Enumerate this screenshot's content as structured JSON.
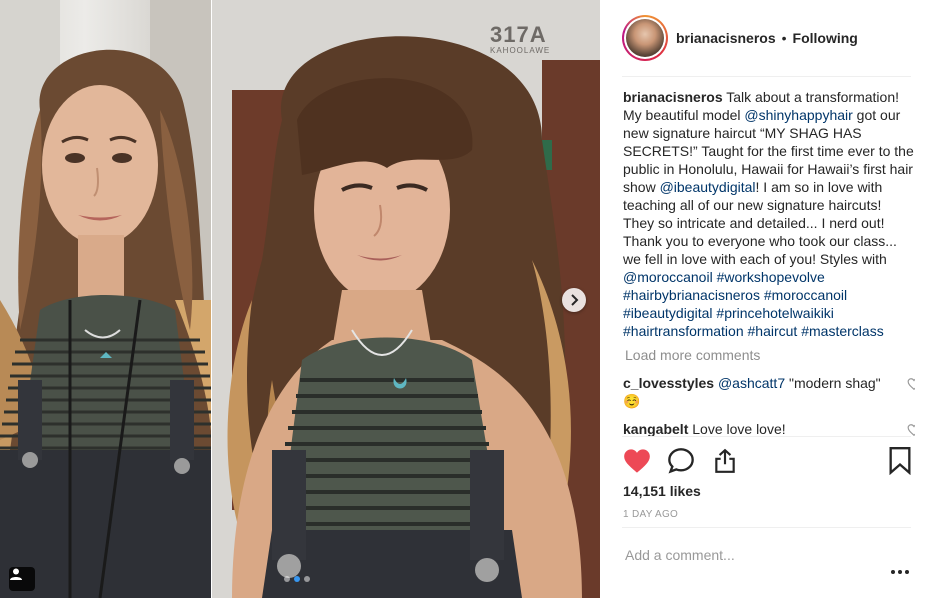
{
  "header": {
    "username": "brianacisneros",
    "separator": "•",
    "follow_state": "Following"
  },
  "wall_sign": {
    "number": "317A",
    "sub": "KAHOOLAWE"
  },
  "caption": {
    "username": "brianacisneros",
    "parts": [
      {
        "type": "text",
        "value": " Talk about a transformation! My beautiful model "
      },
      {
        "type": "tag",
        "value": "@shinyhappyhair"
      },
      {
        "type": "text",
        "value": " got our new signature haircut “MY SHAG HAS SECRETS!” Taught for the first time ever to the public in Honolulu, Hawaii for Hawaii’s first hair show "
      },
      {
        "type": "tag",
        "value": "@ibeautydigital"
      },
      {
        "type": "text",
        "value": "! I am so in love with teaching all of our new signature haircuts! They so intricate and detailed... I nerd out! Thank you to everyone who took our class... we fell in love with each of you! Styles with "
      },
      {
        "type": "tag",
        "value": "@moroccanoil"
      },
      {
        "type": "text",
        "value": " "
      },
      {
        "type": "tag",
        "value": "#workshopevolve"
      },
      {
        "type": "text",
        "value": " "
      },
      {
        "type": "tag",
        "value": "#hairbybrianacisneros"
      },
      {
        "type": "text",
        "value": " "
      },
      {
        "type": "tag",
        "value": "#moroccanoil"
      },
      {
        "type": "text",
        "value": " "
      },
      {
        "type": "tag",
        "value": "#ibeautydigital"
      },
      {
        "type": "text",
        "value": " "
      },
      {
        "type": "tag",
        "value": "#princehotelwaikiki"
      },
      {
        "type": "text",
        "value": " "
      },
      {
        "type": "tag",
        "value": "#hairtransformation"
      },
      {
        "type": "text",
        "value": " "
      },
      {
        "type": "tag",
        "value": "#haircut"
      },
      {
        "type": "text",
        "value": " "
      },
      {
        "type": "tag",
        "value": "#masterclass"
      }
    ]
  },
  "load_more_label": "Load more comments",
  "comments": [
    {
      "username": "c_lovesstyles",
      "parts": [
        {
          "type": "text",
          "value": " "
        },
        {
          "type": "tag",
          "value": "@ashcatt7"
        },
        {
          "type": "text",
          "value": " \"modern shag\" ☺️"
        }
      ]
    },
    {
      "username": "kangabelt",
      "parts": [
        {
          "type": "text",
          "value": " Love love love!"
        }
      ]
    }
  ],
  "actions": {
    "like_icon": "heart-filled-icon",
    "comment_icon": "comment-icon",
    "share_icon": "share-icon",
    "save_icon": "bookmark-icon",
    "liked_color": "#ed4956"
  },
  "likes_label": "14,151 likes",
  "time_label": "1 DAY AGO",
  "add_comment_placeholder": "Add a comment...",
  "carousel": {
    "current_index": 1,
    "total": 3,
    "active_color": "#3897f0"
  }
}
